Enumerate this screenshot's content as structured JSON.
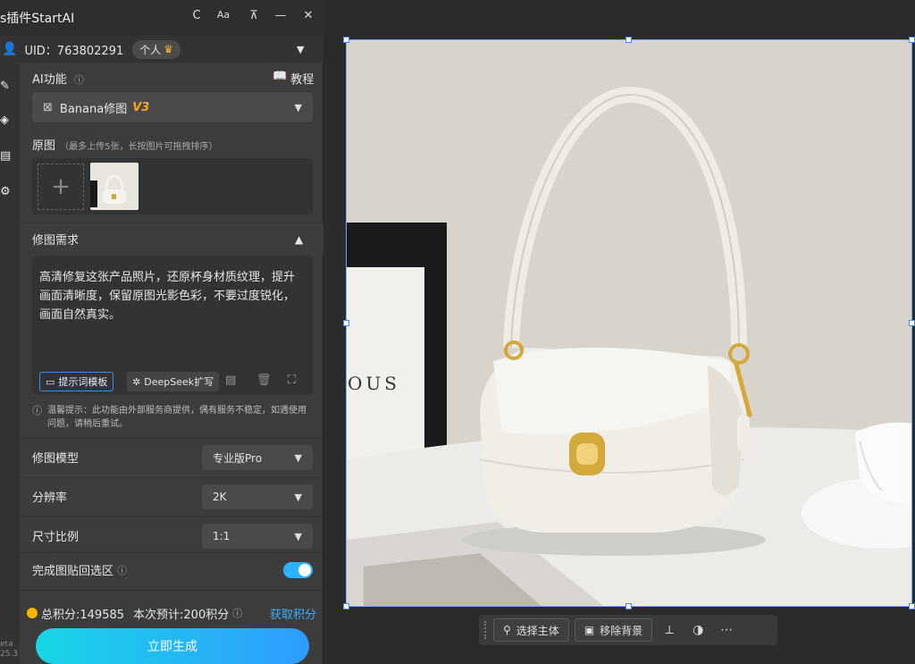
{
  "app": {
    "title": "s插件StartAI",
    "controls": [
      "C",
      "Aa",
      "⊼",
      "—",
      "✕"
    ]
  },
  "account": {
    "uid_label": "UID：763802291",
    "plan": "个人"
  },
  "ai_function": {
    "label": "AI功能",
    "tutorial": "教程",
    "selected": "Banana修图",
    "version": "V3"
  },
  "source_image": {
    "label": "原图",
    "hint": "（最多上传5张，长按图片可拖拽排序）"
  },
  "requirements": {
    "label": "修图需求",
    "text": "高清修复这张产品照片，还原杯身材质纹理，提升画面清晰度，保留原图光影色彩，不要过度锐化，画面自然真实。",
    "template_button": "提示词模板",
    "deepseek_button": "DeepSeek扩写",
    "notice": "温馨提示：此功能由外部服务商提供，偶有服务不稳定，如遇使用问题，请稍后重试。"
  },
  "settings": {
    "model_label": "修图模型",
    "model_value": "专业版Pro",
    "resolution_label": "分辨率",
    "resolution_value": "2K",
    "ratio_label": "尺寸比例",
    "ratio_value": "1:1",
    "paste_back_label": "完成图贴回选区",
    "paste_back_on": true
  },
  "footer": {
    "points": "总积分:149585",
    "estimate": "本次预计:200积分",
    "get_points": "获取积分",
    "generate": "立即生成",
    "version_line1": "eta",
    "version_line2": "25.3"
  },
  "canvas_toolbar": {
    "select_subject": "选择主体",
    "remove_bg": "移除背景"
  },
  "photo": {
    "box_text": "OUS"
  },
  "colors": {
    "accent_blue": "#2bb3ff",
    "version_orange": "#f5a623",
    "generate_gradient_start": "#18d6e6",
    "generate_gradient_end": "#2f9cff"
  }
}
